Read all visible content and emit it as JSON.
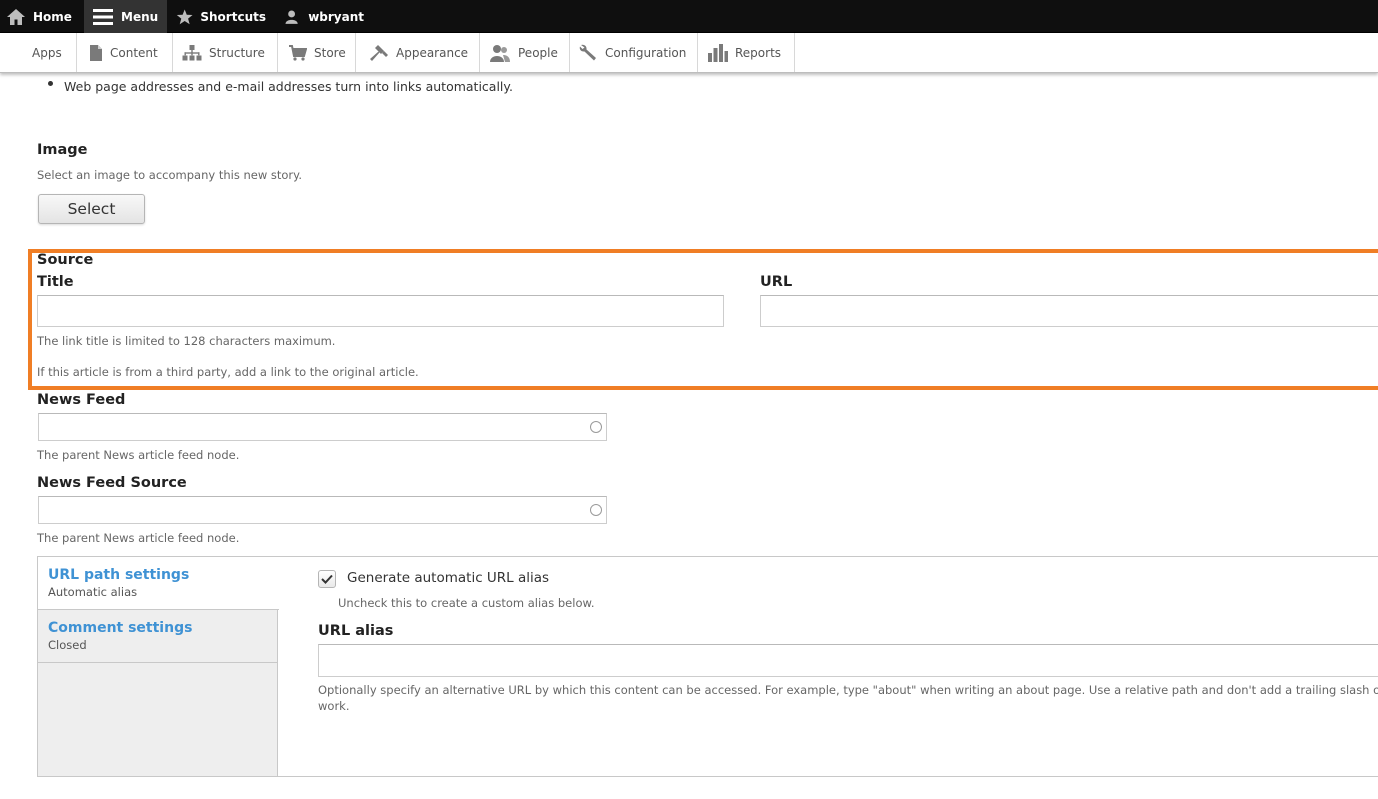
{
  "toolbar": {
    "home": "Home",
    "menu": "Menu",
    "shortcuts": "Shortcuts",
    "user": "wbryant"
  },
  "tray": {
    "items": [
      {
        "label": "Apps",
        "icon": ""
      },
      {
        "label": "Content",
        "icon": "file-icon"
      },
      {
        "label": "Structure",
        "icon": "sitemap-icon"
      },
      {
        "label": "Store",
        "icon": "cart-icon"
      },
      {
        "label": "Appearance",
        "icon": "brush-icon"
      },
      {
        "label": "People",
        "icon": "people-icon"
      },
      {
        "label": "Configuration",
        "icon": "wrench-icon"
      },
      {
        "label": "Reports",
        "icon": "bar-chart-icon"
      }
    ]
  },
  "format_tip": "Web page addresses and e-mail addresses turn into links automatically.",
  "image_field": {
    "label": "Image",
    "description": "Select an image to accompany this new story.",
    "button": "Select"
  },
  "source_field": {
    "label": "Source",
    "title_label": "Title",
    "title_value": "",
    "url_label": "URL",
    "url_value": "",
    "title_help": "The link title is limited to 128 characters maximum.",
    "description": "If this article is from a third party, add a link to the original article.",
    "highlight_color": "#f07e25"
  },
  "news_feed": {
    "label": "News Feed",
    "value": "",
    "description": "The parent News article feed node."
  },
  "news_feed_source": {
    "label": "News Feed Source",
    "value": "",
    "description": "The parent News article feed node."
  },
  "vertical_tabs": [
    {
      "title": "URL path settings",
      "summary": "Automatic alias"
    },
    {
      "title": "Comment settings",
      "summary": "Closed"
    }
  ],
  "url_path": {
    "checkbox_label": "Generate automatic URL alias",
    "checkbox_checked": true,
    "checkbox_help": "Uncheck this to create a custom alias below.",
    "alias_label": "URL alias",
    "alias_value": "",
    "alias_help_line1": "Optionally specify an alternative URL by which this content can be accessed. For example, type \"about\" when writing an about page. Use a relative path and don't add a trailing slash or",
    "alias_help_line2": "work."
  },
  "colors": {
    "link_blue": "#3f92d4",
    "toolbar_bg": "#0f0f0f"
  }
}
